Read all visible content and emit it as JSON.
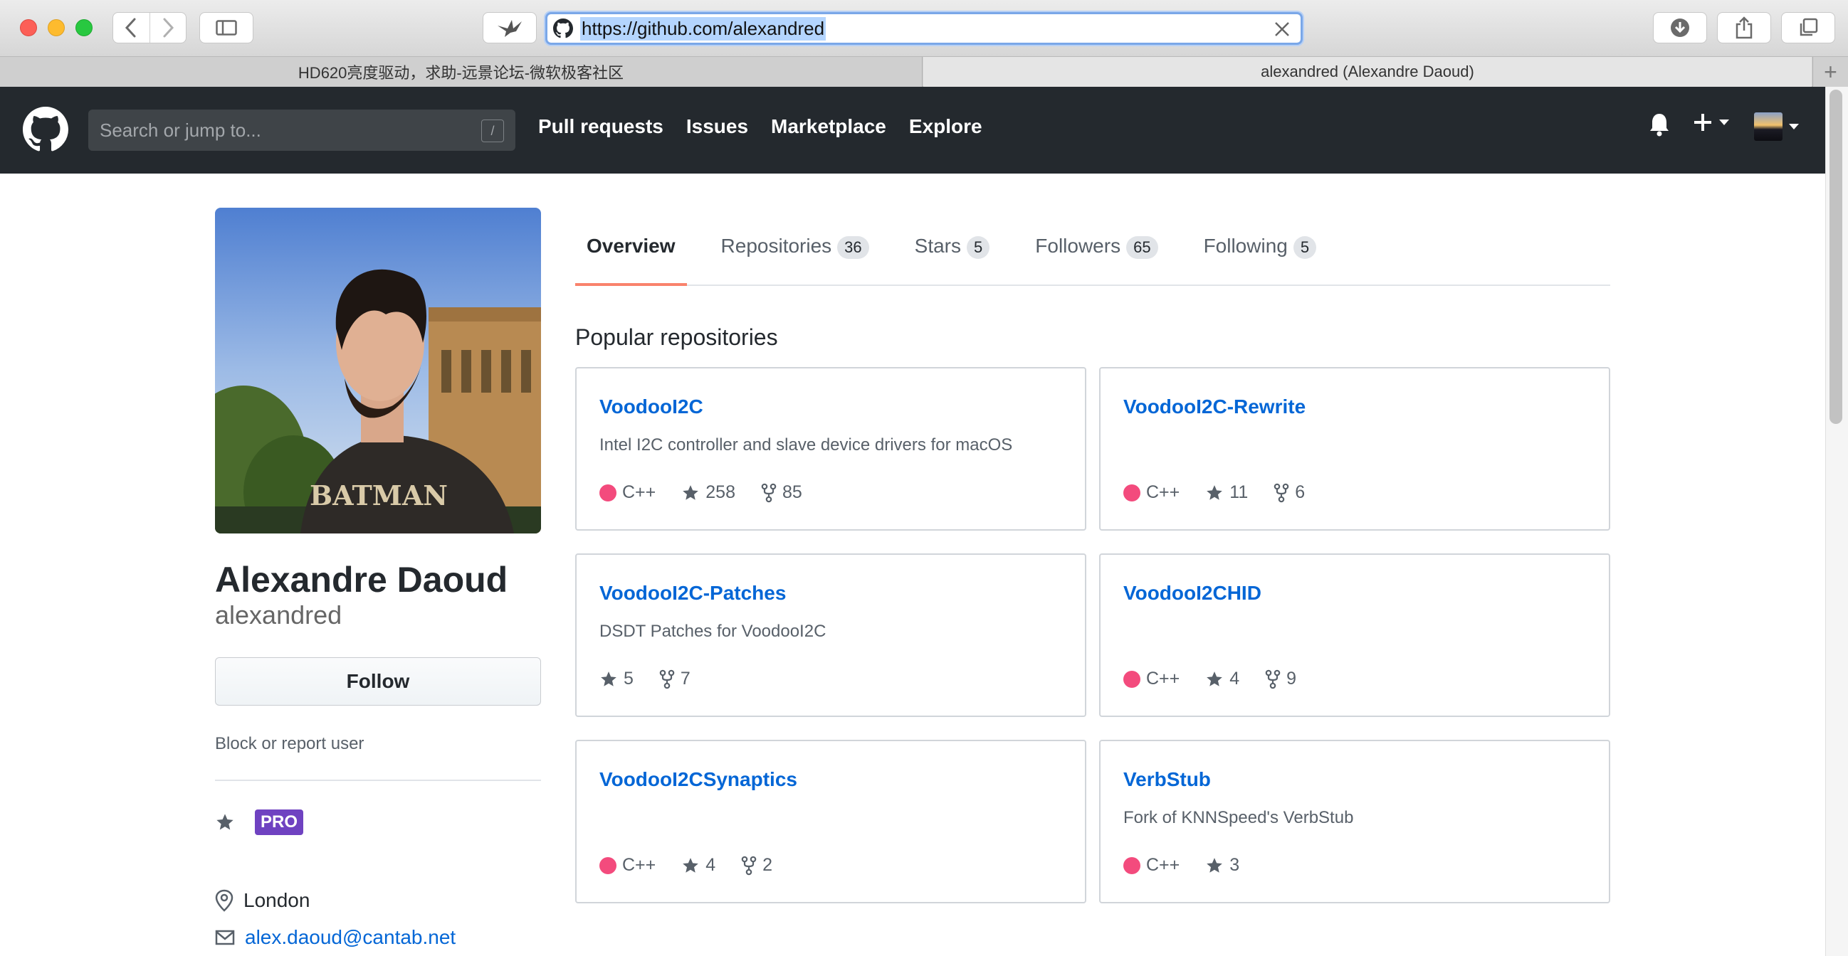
{
  "browser": {
    "url": "https://github.com/alexandred",
    "tabs": [
      {
        "label": "HD620亮度驱动，求助-远景论坛-微软极客社区"
      },
      {
        "label": "alexandred (Alexandre Daoud)"
      }
    ],
    "new_tab_label": "+"
  },
  "header": {
    "search_placeholder": "Search or jump to...",
    "search_shortcut": "/",
    "nav": [
      "Pull requests",
      "Issues",
      "Marketplace",
      "Explore"
    ]
  },
  "profile": {
    "name": "Alexandre Daoud",
    "login": "alexandred",
    "follow_label": "Follow",
    "block_label": "Block or report user",
    "pro_badge": "PRO",
    "location": "London",
    "email": "alex.daoud@cantab.net"
  },
  "tabs": {
    "overview": "Overview",
    "repositories": {
      "label": "Repositories",
      "count": "36"
    },
    "stars": {
      "label": "Stars",
      "count": "5"
    },
    "followers": {
      "label": "Followers",
      "count": "65"
    },
    "following": {
      "label": "Following",
      "count": "5"
    }
  },
  "popular_heading": "Popular repositories",
  "repos": [
    {
      "name": "VoodooI2C",
      "description": "Intel I2C controller and slave device drivers for macOS",
      "language": "C++",
      "stars": "258",
      "forks": "85"
    },
    {
      "name": "VoodooI2C-Rewrite",
      "description": "",
      "language": "C++",
      "stars": "11",
      "forks": "6"
    },
    {
      "name": "VoodooI2C-Patches",
      "description": "DSDT Patches for VoodooI2C",
      "language": "",
      "stars": "5",
      "forks": "7"
    },
    {
      "name": "VoodooI2CHID",
      "description": "",
      "language": "C++",
      "stars": "4",
      "forks": "9"
    },
    {
      "name": "VoodooI2CSynaptics",
      "description": "",
      "language": "C++",
      "stars": "4",
      "forks": "2"
    },
    {
      "name": "VerbStub",
      "description": "Fork of KNNSpeed's VerbStub",
      "language": "C++",
      "stars": "3",
      "forks": ""
    }
  ],
  "colors": {
    "header_bg": "#24292e",
    "link": "#0366d6",
    "cpp_language": "#f34b7d",
    "active_tab_underline": "#f9826c",
    "pro_badge": "#6f42c1"
  }
}
